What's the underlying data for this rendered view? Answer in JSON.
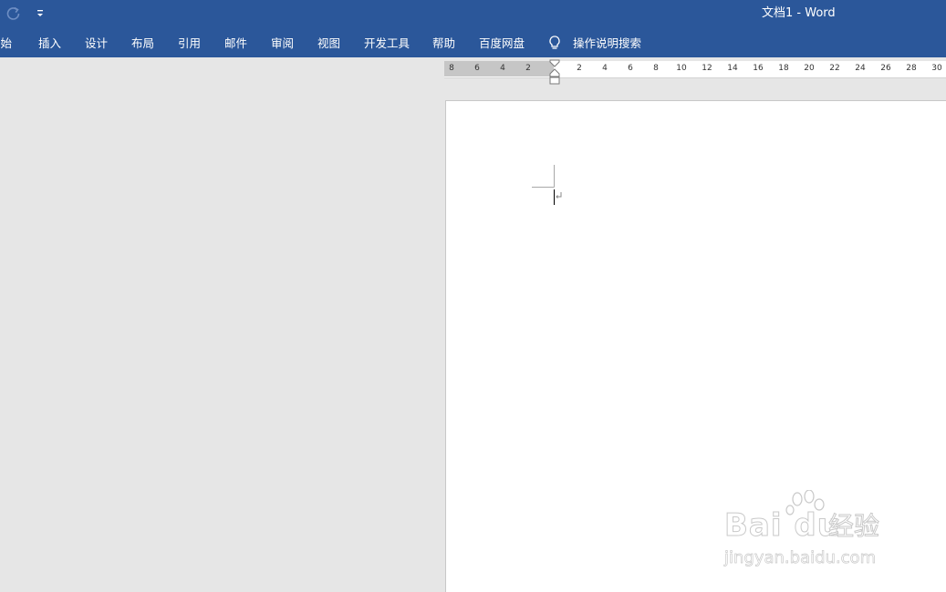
{
  "title_bar": {
    "title": "文档1  -  Word",
    "redo_icon": "redo-icon",
    "customize_icon": "customize-quick-access-icon"
  },
  "ribbon": {
    "tabs": [
      {
        "label": "开始"
      },
      {
        "label": "插入"
      },
      {
        "label": "设计"
      },
      {
        "label": "布局"
      },
      {
        "label": "引用"
      },
      {
        "label": "邮件"
      },
      {
        "label": "审阅"
      },
      {
        "label": "视图"
      },
      {
        "label": "开发工具"
      },
      {
        "label": "帮助"
      },
      {
        "label": "百度网盘"
      }
    ],
    "tell_me": {
      "icon": "lightbulb-icon",
      "label": "操作说明搜索"
    }
  },
  "ruler": {
    "left_labels": [
      "8",
      "6",
      "4",
      "2"
    ],
    "right_labels": [
      "2",
      "4",
      "6",
      "8",
      "10",
      "12",
      "14",
      "16",
      "18",
      "20",
      "22",
      "24",
      "26",
      "28",
      "30"
    ]
  },
  "watermark": {
    "brand": "Bai du",
    "brand_cn": "经验",
    "url": "jingyan.baidu.com"
  },
  "colors": {
    "ribbon": "#2b579a",
    "workspace": "#e6e6e6",
    "page": "#ffffff"
  }
}
